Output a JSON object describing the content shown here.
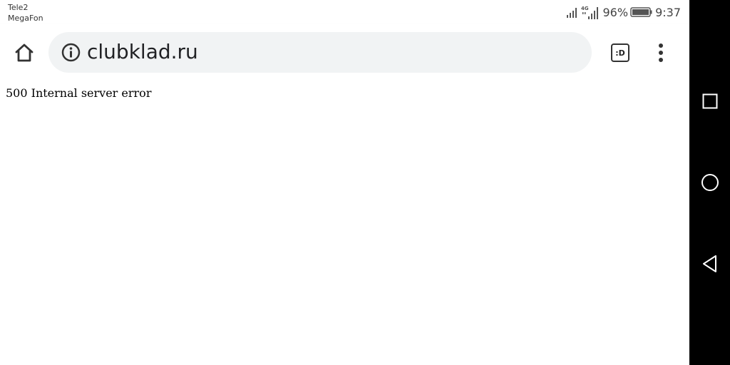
{
  "status_bar": {
    "carrier_1": "Tele2",
    "carrier_2": "MegaFon",
    "network_type": "4G",
    "battery_percent": "96%",
    "time": "9:37"
  },
  "browser": {
    "url": "clubklad.ru",
    "tabs_label": ":D"
  },
  "page": {
    "error_message": "500 Internal server error"
  },
  "icons": {
    "home": "home-icon",
    "info": "info-icon",
    "tabs": "tab-switcher-icon",
    "menu": "more-vert-icon",
    "recents": "square-icon",
    "home_nav": "circle-icon",
    "back": "triangle-back-icon"
  }
}
